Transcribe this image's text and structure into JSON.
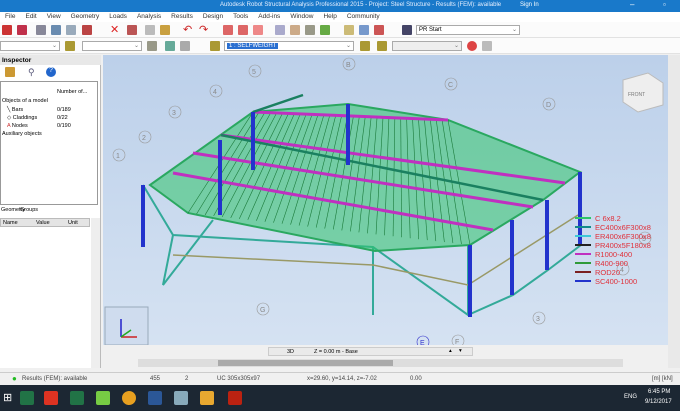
{
  "window": {
    "title": "Autodesk Robot Structural Analysis Professional 2015 - Project: Steel Structure - Results (FEM): available",
    "sign_in": "Sign In"
  },
  "menu": [
    "File",
    "Edit",
    "View",
    "Geometry",
    "Loads",
    "Analysis",
    "Results",
    "Design",
    "Tools",
    "Add-ins",
    "Window",
    "Help",
    "Community"
  ],
  "toolbar": {
    "layout_select": "PR Start",
    "load_case": "1 : SELFWEIGHT"
  },
  "inspector": {
    "title": "Inspector",
    "col_number": "Number of...",
    "group": "Objects of a model",
    "items": [
      {
        "label": "Bars",
        "value": "0/189"
      },
      {
        "label": "Claddings",
        "value": "0/22"
      },
      {
        "label": "Nodes",
        "value": "0/190"
      }
    ],
    "aux": "Auxiliary objects",
    "tabs": [
      "Geometry",
      "Groups"
    ],
    "prop_cols": [
      "Name",
      "Value",
      "Unit"
    ]
  },
  "view": {
    "cube_label": "FRONT",
    "legend": [
      {
        "label": "C 6x8.2",
        "color": "#2fc46a"
      },
      {
        "label": "EC400x6F300x8",
        "color": "#138a8a"
      },
      {
        "label": "ER400x6F300x8",
        "color": "#3cc8d8"
      },
      {
        "label": "PR400x5F180x8",
        "color": "#222222"
      },
      {
        "label": "R1000-400",
        "color": "#c030c0"
      },
      {
        "label": "R400-900",
        "color": "#2f9a3a"
      },
      {
        "label": "ROD20",
        "color": "#7a2020"
      },
      {
        "label": "SC400-1000",
        "color": "#2233cc"
      }
    ],
    "legend_text_color": "#e0303a",
    "grid_labels": [
      "5",
      "4",
      "3",
      "2",
      "1",
      "B",
      "C",
      "D",
      "E",
      "F",
      "G",
      "3",
      "4",
      "5"
    ],
    "mode": "3D",
    "level": "Z = 0.00 m - Base"
  },
  "status": {
    "results": "Results (FEM): available",
    "num1": "455",
    "num2": "2",
    "section": "UC 305x305x97",
    "coords": "x=29.60, y=14.14, z=-7.02",
    "angle": "0.00",
    "units": "[m] [kN]"
  },
  "taskbar": {
    "lang": "ENG",
    "time": "6:45 PM",
    "date": "9/12/2017"
  }
}
